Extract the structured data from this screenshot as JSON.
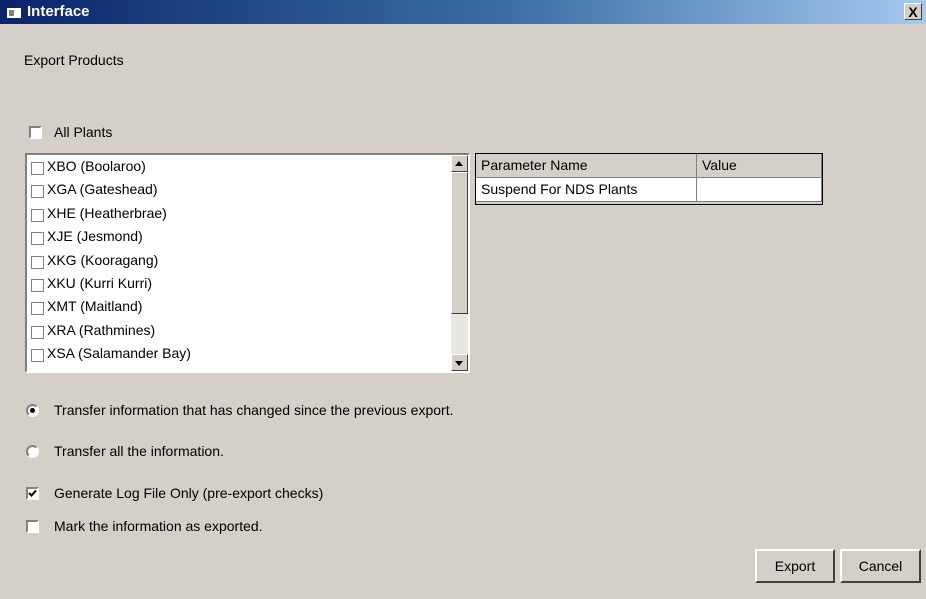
{
  "window": {
    "title": "Interface",
    "close_label": "X"
  },
  "header": {
    "subtitle": "Export Products"
  },
  "all_plants": {
    "label": "All Plants",
    "checked": false
  },
  "plants": {
    "items": [
      {
        "label": "XBO (Boolaroo)"
      },
      {
        "label": "XGA (Gateshead)"
      },
      {
        "label": "XHE (Heatherbrae)"
      },
      {
        "label": "XJE (Jesmond)"
      },
      {
        "label": "XKG (Kooragang)"
      },
      {
        "label": "XKU (Kurri Kurri)"
      },
      {
        "label": "XMT (Maitland)"
      },
      {
        "label": "XRA (Rathmines)"
      },
      {
        "label": "XSA (Salamander Bay)"
      }
    ]
  },
  "params": {
    "headers": [
      "Parameter Name",
      "Value"
    ],
    "rows": [
      [
        "Suspend For NDS Plants",
        ""
      ]
    ]
  },
  "transfer": {
    "changed_label": "Transfer information that has changed since the previous export.",
    "all_label": "Transfer all the information.",
    "selected": "changed"
  },
  "options": {
    "log_only_label": "Generate Log File Only (pre-export checks)",
    "log_only_checked": true,
    "mark_exported_label": "Mark the information as exported.",
    "mark_exported_checked": false
  },
  "buttons": {
    "export": "Export",
    "cancel": "Cancel"
  }
}
